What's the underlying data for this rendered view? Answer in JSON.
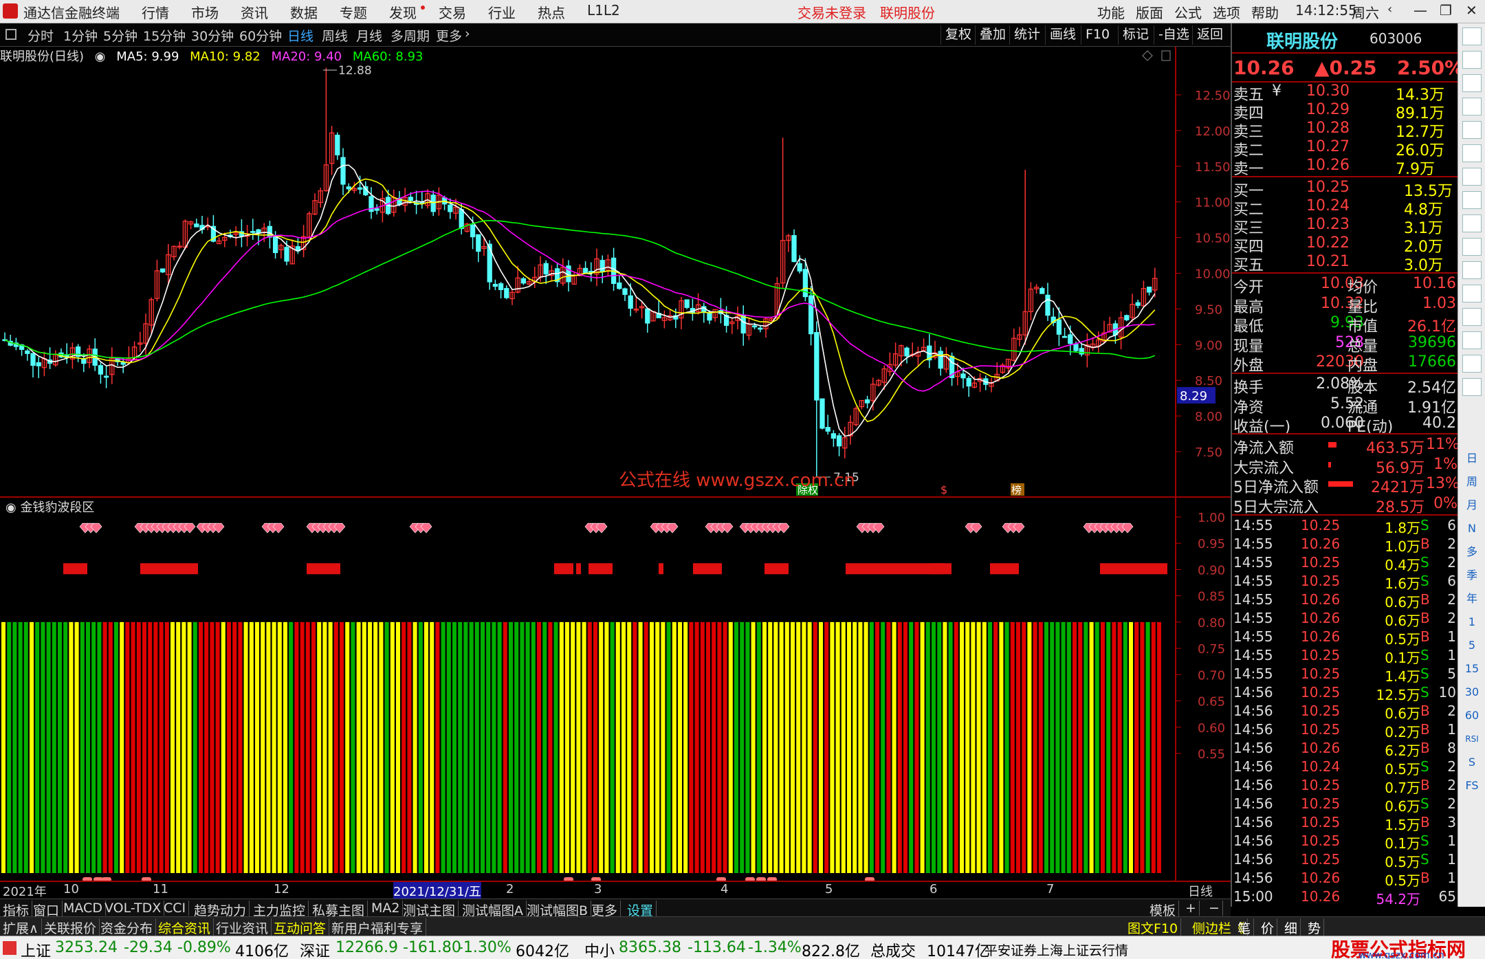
{
  "app": {
    "name": "通达信金融终端",
    "menus": [
      "行情",
      "市场",
      "资讯",
      "数据",
      "专题",
      "发现",
      "交易",
      "行业",
      "热点",
      "L1L2"
    ],
    "login": "交易未登录",
    "stock_link": "联明股份",
    "right_menus": [
      "功能",
      "版面",
      "公式",
      "选项",
      "帮助"
    ],
    "time": "14:12:55",
    "weekday": "周六"
  },
  "timeframes": [
    "分时",
    "1分钟",
    "5分钟",
    "15分钟",
    "30分钟",
    "60分钟",
    "日线",
    "周线",
    "月线",
    "多周期",
    "更多"
  ],
  "tools": [
    "复权",
    "叠加",
    "统计",
    "画线",
    "F10",
    "标记",
    "-自选",
    "返回"
  ],
  "info": {
    "name": "联明股份(日线)",
    "ma5": "MA5: 9.99",
    "ma10": "MA10: 9.82",
    "ma20": "MA20: 9.40",
    "ma60": "MA60: 8.93",
    "high_label": "12.88",
    "low_label": "7.15",
    "cur_tag": "8.29",
    "watermark": "公式在线 www.gszx.com.cn",
    "ind_title": "金钱豹波段区"
  },
  "marks": {
    "m1": "除权",
    "m2": "$",
    "m3": "榜"
  },
  "y_main": [
    "12.50",
    "12.00",
    "11.50",
    "11.00",
    "10.50",
    "10.00",
    "9.50",
    "9.00",
    "8.50",
    "8.00",
    "7.50"
  ],
  "y_ind": [
    "1.00",
    "0.95",
    "0.90",
    "0.85",
    "0.80",
    "0.75",
    "0.70",
    "0.65",
    "0.60",
    "0.55"
  ],
  "x_axis": {
    "labels": [
      "2021年",
      "10",
      "11",
      "12",
      "2021/12/31/五",
      "2",
      "3",
      "4",
      "5",
      "6",
      "7"
    ],
    "period": "日线"
  },
  "quote": {
    "name": "联明股份",
    "code": "603006",
    "price": "10.26",
    "chg": "▲0.25",
    "pct": "2.50%",
    "sells": [
      [
        "卖五",
        "¥",
        "10.30",
        "14.3万"
      ],
      [
        "卖四",
        "",
        "10.29",
        "89.1万"
      ],
      [
        "卖三",
        "",
        "10.28",
        "12.7万"
      ],
      [
        "卖二",
        "",
        "10.27",
        "26.0万"
      ],
      [
        "卖一",
        "",
        "10.26",
        "7.9万"
      ]
    ],
    "buys": [
      [
        "买一",
        "10.25",
        "13.5万"
      ],
      [
        "买二",
        "10.24",
        "4.8万"
      ],
      [
        "买三",
        "10.23",
        "3.1万"
      ],
      [
        "买四",
        "10.22",
        "2.0万"
      ],
      [
        "买五",
        "10.21",
        "3.0万"
      ]
    ],
    "stats": [
      [
        "今开",
        "10.03",
        "均价",
        "10.16"
      ],
      [
        "最高",
        "10.32",
        "量比",
        "1.03"
      ],
      [
        "最低",
        "9.93",
        "市值",
        "26.1亿"
      ],
      [
        "现量",
        "528",
        "总量",
        "39696"
      ],
      [
        "外盘",
        "22030",
        "内盘",
        "17666"
      ]
    ],
    "stats2": [
      [
        "换手",
        "2.08%",
        "股本",
        "2.54亿"
      ],
      [
        "净资",
        "5.52",
        "流通",
        "1.91亿"
      ],
      [
        "收益(一)",
        "0.060",
        "PE(动)",
        "40.2"
      ]
    ],
    "flows": [
      [
        "净流入额",
        "463.5万",
        "11%"
      ],
      [
        "大宗流入",
        "56.9万",
        "1%"
      ],
      [
        "5日净流入额",
        "2421万",
        "13%"
      ],
      [
        "5日大宗流入",
        "28.5万",
        "0%"
      ]
    ],
    "ticks": [
      [
        "14:55",
        "10.25",
        "1.8万",
        "S",
        "6"
      ],
      [
        "14:55",
        "10.26",
        "1.0万",
        "B",
        "2"
      ],
      [
        "14:55",
        "10.25",
        "0.4万",
        "S",
        "2"
      ],
      [
        "14:55",
        "10.25",
        "1.6万",
        "S",
        "6"
      ],
      [
        "14:55",
        "10.26",
        "0.6万",
        "B",
        "2"
      ],
      [
        "14:55",
        "10.26",
        "0.6万",
        "B",
        "2"
      ],
      [
        "14:55",
        "10.26",
        "0.5万",
        "B",
        "1"
      ],
      [
        "14:55",
        "10.25",
        "0.1万",
        "S",
        "1"
      ],
      [
        "14:55",
        "10.25",
        "1.4万",
        "S",
        "5"
      ],
      [
        "14:56",
        "10.25",
        "12.5万",
        "S",
        "10"
      ],
      [
        "14:56",
        "10.25",
        "0.6万",
        "B",
        "2"
      ],
      [
        "14:56",
        "10.25",
        "0.2万",
        "B",
        "1"
      ],
      [
        "14:56",
        "10.26",
        "6.2万",
        "B",
        "8"
      ],
      [
        "14:56",
        "10.24",
        "0.5万",
        "S",
        "2"
      ],
      [
        "14:56",
        "10.25",
        "0.7万",
        "B",
        "2"
      ],
      [
        "14:56",
        "10.25",
        "0.6万",
        "S",
        "2"
      ],
      [
        "14:56",
        "10.25",
        "1.5万",
        "B",
        "3"
      ],
      [
        "14:56",
        "10.25",
        "0.1万",
        "S",
        "1"
      ],
      [
        "14:56",
        "10.25",
        "0.5万",
        "S",
        "1"
      ],
      [
        "14:56",
        "10.26",
        "0.5万",
        "B",
        "1"
      ],
      [
        "15:00",
        "10.26",
        "54.2万",
        "",
        "65"
      ]
    ]
  },
  "side_tools": [
    "日",
    "周",
    "月",
    "N",
    "多",
    "季",
    "年",
    "1",
    "5",
    "15",
    "30",
    "60",
    "RSI",
    "S",
    "FS"
  ],
  "tabs1": [
    "指标",
    "窗口",
    "MACD",
    "VOL-TDX",
    "CCI",
    "趋势动力",
    "主力监控",
    "私募主图",
    "MA2",
    "测试主图",
    "测试幅图A",
    "测试幅图B",
    "更多",
    "设置"
  ],
  "tabs1_right": [
    "模板",
    "+",
    "−"
  ],
  "tabs2": [
    "扩展∧",
    "关联报价",
    "资金分布",
    "综合资讯",
    "行业资讯",
    "互动问答",
    "新用户福利专享"
  ],
  "tabs2_right": [
    "图文F10",
    "侧边栏《",
    "笔",
    "价",
    "细",
    "势"
  ],
  "status": {
    "sh_name": "上证",
    "sh_val": "3253.24",
    "sh_chg": "-29.34",
    "sh_pct": "-0.89%",
    "sh_amt": "4106亿",
    "sz_name": "深证",
    "sz_val": "12266.9",
    "sz_chg": "-161.80",
    "sz_pct": "-1.30%",
    "sz_amt": "6042亿",
    "zx_name": "中小",
    "zx_val": "8365.38",
    "zx_chg": "-113.64",
    "zx_pct": "-1.34%",
    "zx_amt": "822.8亿",
    "total_name": "总成交",
    "total_amt": "10147亿",
    "broker": "平安证券上海上证云行情",
    "logo1": "股票公式指标网",
    "logo2": "www.gszx.com.cn"
  },
  "colors": {
    "up": "#ff3232",
    "down": "#54fcfc",
    "ma5": "#ffffff",
    "ma10": "#ffff00",
    "ma20": "#ff00ff",
    "ma60": "#00ff00",
    "band_red": "#e00000",
    "band_green": "#00b000",
    "band_yellow": "#ffff00"
  }
}
